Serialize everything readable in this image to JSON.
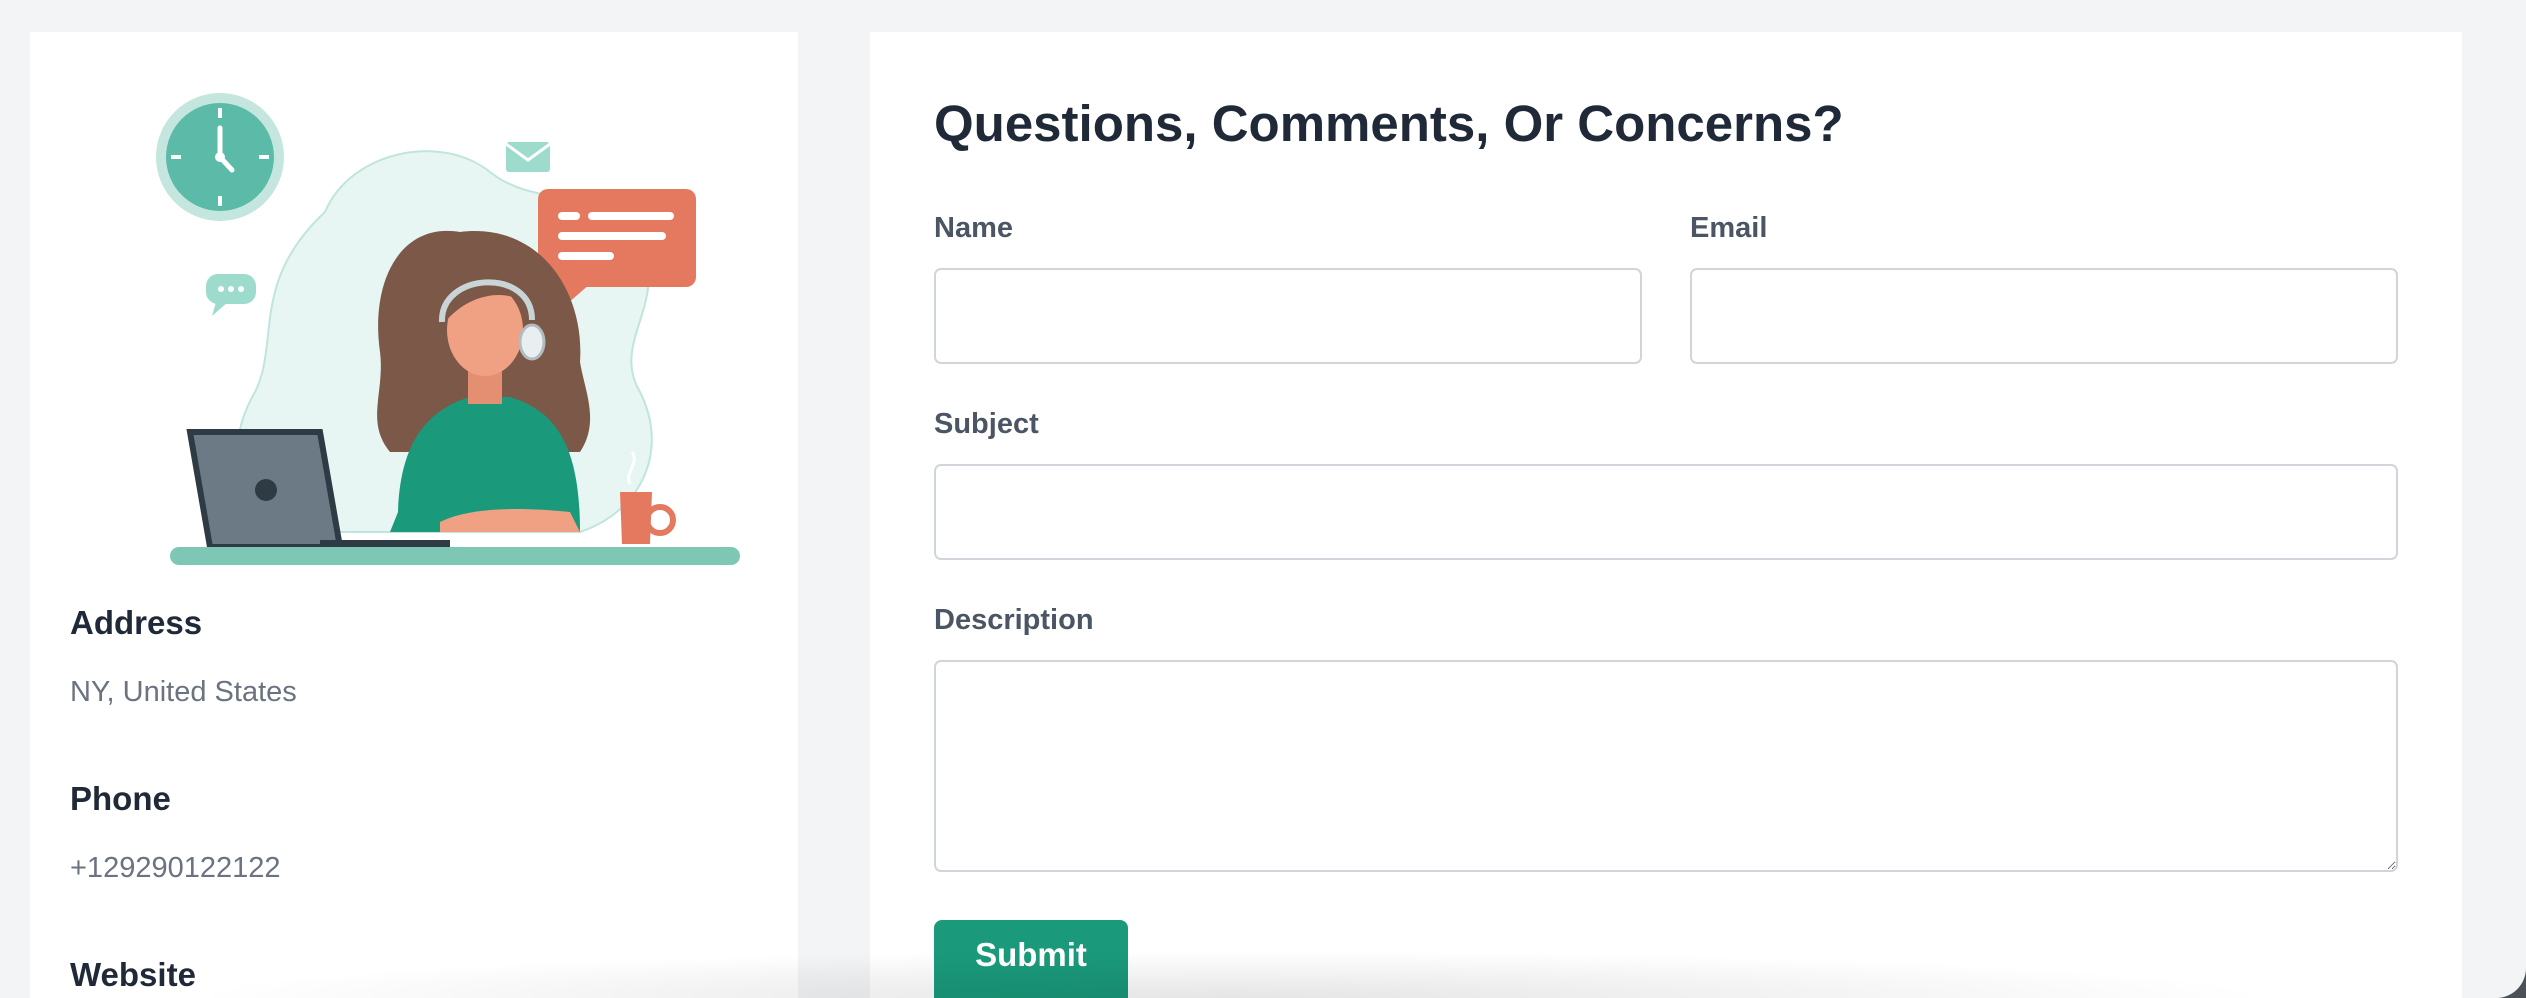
{
  "contact_info": {
    "address_label": "Address",
    "address_value": "NY, United States",
    "phone_label": "Phone",
    "phone_value": "+129290122122",
    "website_label": "Website"
  },
  "illustration": {
    "icon": "customer-support-illustration",
    "colors": {
      "teal": "#5cbba8",
      "light_teal": "#e8f6f3",
      "coral": "#e5795f",
      "shirt": "#1a9a7b",
      "hair": "#7b5847",
      "skin": "#f0a183",
      "laptop": "#6b7a84"
    }
  },
  "form": {
    "title": "Questions, Comments, Or Concerns?",
    "name_label": "Name",
    "name_value": "",
    "email_label": "Email",
    "email_value": "",
    "subject_label": "Subject",
    "subject_value": "",
    "description_label": "Description",
    "description_value": "",
    "submit_label": "Submit"
  },
  "colors": {
    "background": "#f3f4f6",
    "card": "#ffffff",
    "accent": "#1a9a7b",
    "heading": "#1f2937",
    "muted": "#6b7280",
    "border": "#d1d5db"
  }
}
